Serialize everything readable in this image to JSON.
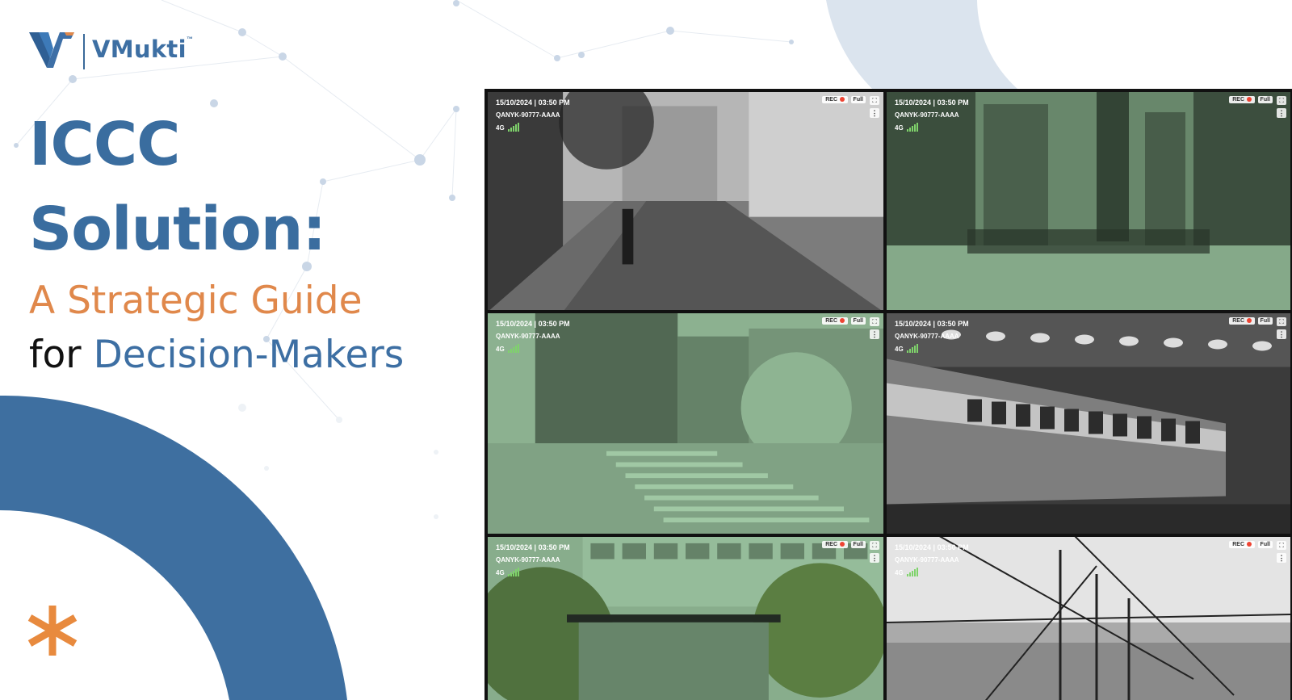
{
  "brand": {
    "name": "VMukti",
    "tm": "™"
  },
  "headline": {
    "line1": "ICCC",
    "line2": "Solution:",
    "line3": "A Strategic Guide",
    "line4_prefix": "for",
    "line4_highlight": "Decision-Makers"
  },
  "colors": {
    "primary_blue": "#3d6fa3",
    "accent_orange": "#e0884b",
    "dark_text": "#111111"
  },
  "feeds": [
    {
      "date": "15/10/2024 | 03:50 PM",
      "camera_id": "QANYK-90777-AAAA",
      "network": "4G",
      "rec_label": "REC",
      "full_label": "Full",
      "tint": "grayscale",
      "scene": "street"
    },
    {
      "date": "15/10/2024 | 03:50 PM",
      "camera_id": "QANYK-90777-AAAA",
      "network": "4G",
      "rec_label": "REC",
      "full_label": "Full",
      "tint": "green",
      "scene": "city"
    },
    {
      "date": "15/10/2024 | 03:50 PM",
      "camera_id": "QANYK-90777-AAAA",
      "network": "4G",
      "rec_label": "REC",
      "full_label": "Full",
      "tint": "green",
      "scene": "crossing"
    },
    {
      "date": "15/10/2024 | 03:50 PM",
      "camera_id": "QANYK-90777-AAAA",
      "network": "4G",
      "rec_label": "REC",
      "full_label": "Full",
      "tint": "grayscale",
      "scene": "train"
    },
    {
      "date": "15/10/2024 | 03:50 PM",
      "camera_id": "QANYK-90777-AAAA",
      "network": "4G",
      "rec_label": "REC",
      "full_label": "Full",
      "tint": "green",
      "scene": "busstop"
    },
    {
      "date": "15/10/2024 | 03:50 PM",
      "camera_id": "QANYK-90777-AAAA",
      "network": "4G",
      "rec_label": "REC",
      "full_label": "Full",
      "tint": "grayscale",
      "scene": "fence"
    }
  ]
}
